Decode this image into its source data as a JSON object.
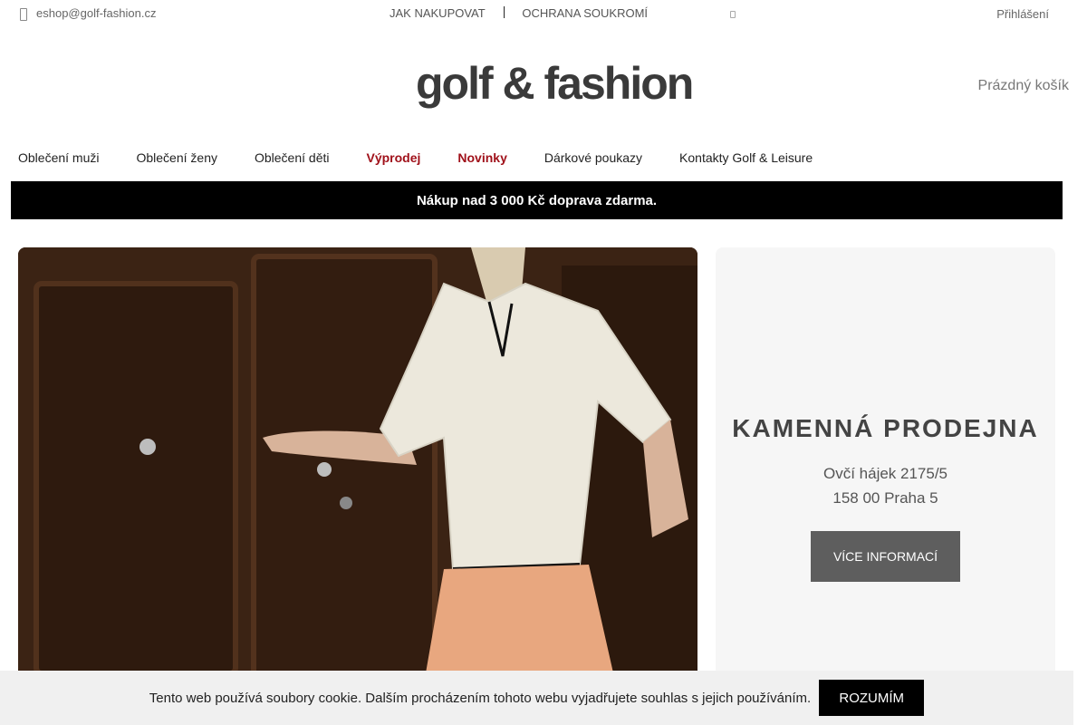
{
  "topbar": {
    "email": "eshop@golf-fashion.cz",
    "email_icon": "phone-icon",
    "links": [
      "JAK NAKUPOVAT",
      "OCHRANA SOUKROMÍ"
    ],
    "separator": "|",
    "login": "Přihlášení"
  },
  "header": {
    "logo_text": "golf & fashion",
    "cart": "Prázdný košík"
  },
  "nav": {
    "items": [
      {
        "label": "Oblečení muži"
      },
      {
        "label": "Oblečení ženy"
      },
      {
        "label": "Oblečení děti"
      },
      {
        "label": "Výprodej"
      },
      {
        "label": "Novinky"
      },
      {
        "label": "Dárkové poukazy"
      },
      {
        "label": "Kontakty Golf & Leisure"
      }
    ],
    "highlight_color": "#a0111a"
  },
  "promo": {
    "text": "Nákup nad 3 000 Kč doprava zdarma."
  },
  "store": {
    "title": "KAMENNÁ PRODEJNA",
    "address_line1": "Ovčí hájek 2175/5",
    "address_line2": "158 00 Praha 5",
    "button": "VÍCE INFORMACÍ"
  },
  "cookie": {
    "message": "Tento web používá soubory cookie. Dalším procházením tohoto webu vyjadřujete souhlas s jejich používáním.",
    "accept": "ROZUMÍM"
  }
}
